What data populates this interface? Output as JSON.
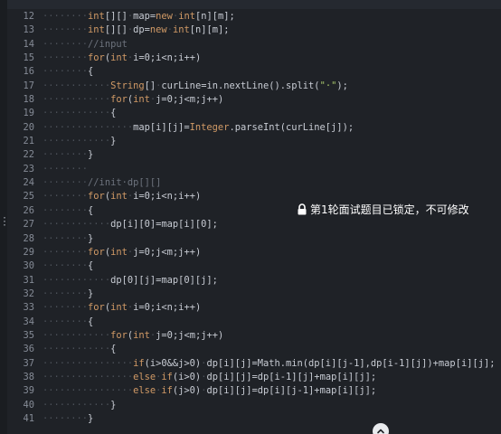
{
  "editor": {
    "lines": [
      {
        "n": "12",
        "indent": 2,
        "parts": [
          [
            "kw",
            "int"
          ],
          [
            "",
            "[][]"
          ],
          [
            "dot",
            "·"
          ],
          [
            "",
            "map="
          ],
          [
            "kw",
            "new"
          ],
          [
            "dot",
            "·"
          ],
          [
            "kw",
            "int"
          ],
          [
            "",
            "[n][m];"
          ]
        ]
      },
      {
        "n": "13",
        "indent": 2,
        "parts": [
          [
            "kw",
            "int"
          ],
          [
            "",
            "[][]"
          ],
          [
            "dot",
            "·"
          ],
          [
            "",
            "dp="
          ],
          [
            "kw",
            "new"
          ],
          [
            "dot",
            "·"
          ],
          [
            "kw",
            "int"
          ],
          [
            "",
            "[n][m];"
          ]
        ]
      },
      {
        "n": "14",
        "indent": 2,
        "parts": [
          [
            "cm",
            "//input"
          ]
        ]
      },
      {
        "n": "15",
        "indent": 2,
        "parts": [
          [
            "kw",
            "for"
          ],
          [
            "",
            "("
          ],
          [
            "kw",
            "int"
          ],
          [
            "dot",
            "·"
          ],
          [
            "",
            "i=0;i<n;i++)"
          ]
        ]
      },
      {
        "n": "16",
        "indent": 2,
        "parts": [
          [
            "",
            "{"
          ]
        ]
      },
      {
        "n": "17",
        "indent": 3,
        "parts": [
          [
            "ty",
            "String"
          ],
          [
            "",
            "[]"
          ],
          [
            "dot",
            "·"
          ],
          [
            "",
            "curLine=in.nextLine().split("
          ],
          [
            "str",
            "\"·\""
          ],
          [
            "",
            ");"
          ]
        ]
      },
      {
        "n": "18",
        "indent": 3,
        "parts": [
          [
            "kw",
            "for"
          ],
          [
            "",
            "("
          ],
          [
            "kw",
            "int"
          ],
          [
            "dot",
            "·"
          ],
          [
            "",
            "j=0;j<m;j++)"
          ]
        ]
      },
      {
        "n": "19",
        "indent": 3,
        "parts": [
          [
            "",
            "{"
          ]
        ]
      },
      {
        "n": "20",
        "indent": 4,
        "parts": [
          [
            "",
            "map[i][j]="
          ],
          [
            "ty",
            "Integer"
          ],
          [
            "",
            ".parseInt(curLine[j]);"
          ]
        ]
      },
      {
        "n": "21",
        "indent": 3,
        "parts": [
          [
            "",
            "}"
          ]
        ]
      },
      {
        "n": "22",
        "indent": 2,
        "parts": [
          [
            "",
            "}"
          ]
        ]
      },
      {
        "n": "23",
        "indent": 2,
        "parts": []
      },
      {
        "n": "24",
        "indent": 2,
        "parts": [
          [
            "cm",
            "//init·dp[][]"
          ]
        ]
      },
      {
        "n": "25",
        "indent": 2,
        "parts": [
          [
            "kw",
            "for"
          ],
          [
            "",
            "("
          ],
          [
            "kw",
            "int"
          ],
          [
            "dot",
            "·"
          ],
          [
            "",
            "i=0;i<n;i++)"
          ]
        ]
      },
      {
        "n": "26",
        "indent": 2,
        "parts": [
          [
            "",
            "{"
          ]
        ]
      },
      {
        "n": "27",
        "indent": 3,
        "parts": [
          [
            "",
            "dp[i][0]=map[i][0];"
          ]
        ]
      },
      {
        "n": "28",
        "indent": 2,
        "parts": [
          [
            "",
            "}"
          ]
        ]
      },
      {
        "n": "29",
        "indent": 2,
        "parts": [
          [
            "kw",
            "for"
          ],
          [
            "",
            "("
          ],
          [
            "kw",
            "int"
          ],
          [
            "dot",
            "·"
          ],
          [
            "",
            "j=0;j<m;j++)"
          ]
        ]
      },
      {
        "n": "30",
        "indent": 2,
        "parts": [
          [
            "",
            "{"
          ]
        ]
      },
      {
        "n": "31",
        "indent": 3,
        "parts": [
          [
            "",
            "dp[0][j]=map[0][j];"
          ]
        ]
      },
      {
        "n": "32",
        "indent": 2,
        "parts": [
          [
            "",
            "}"
          ]
        ]
      },
      {
        "n": "33",
        "indent": 2,
        "parts": [
          [
            "kw",
            "for"
          ],
          [
            "",
            "("
          ],
          [
            "kw",
            "int"
          ],
          [
            "dot",
            "·"
          ],
          [
            "",
            "i=0;i<n;i++)"
          ]
        ]
      },
      {
        "n": "34",
        "indent": 2,
        "parts": [
          [
            "",
            "{"
          ]
        ]
      },
      {
        "n": "35",
        "indent": 3,
        "parts": [
          [
            "kw",
            "for"
          ],
          [
            "",
            "("
          ],
          [
            "kw",
            "int"
          ],
          [
            "dot",
            "·"
          ],
          [
            "",
            "j=0;j<m;j++)"
          ]
        ]
      },
      {
        "n": "36",
        "indent": 3,
        "parts": [
          [
            "",
            "{"
          ]
        ]
      },
      {
        "n": "37",
        "indent": 4,
        "parts": [
          [
            "kw",
            "if"
          ],
          [
            "",
            "(i>0&&j>0)"
          ],
          [
            "dot",
            "·"
          ],
          [
            "",
            "dp[i][j]=Math.min(dp[i][j-1],dp[i-1][j])+map[i][j];"
          ]
        ]
      },
      {
        "n": "38",
        "indent": 4,
        "parts": [
          [
            "kw",
            "else"
          ],
          [
            "dot",
            "·"
          ],
          [
            "kw",
            "if"
          ],
          [
            "",
            "(i>0)"
          ],
          [
            "dot",
            "·"
          ],
          [
            "",
            "dp[i][j]=dp[i-1][j]+map[i][j];"
          ]
        ]
      },
      {
        "n": "39",
        "indent": 4,
        "parts": [
          [
            "kw",
            "else"
          ],
          [
            "dot",
            "·"
          ],
          [
            "kw",
            "if"
          ],
          [
            "",
            "(j>0)"
          ],
          [
            "dot",
            "·"
          ],
          [
            "",
            "dp[i][j]=dp[i][j-1]+map[i][j];"
          ]
        ]
      },
      {
        "n": "40",
        "indent": 3,
        "parts": [
          [
            "",
            "}"
          ]
        ]
      },
      {
        "n": "41",
        "indent": 2,
        "parts": [
          [
            "",
            "}"
          ]
        ]
      }
    ]
  },
  "notice": {
    "text": "第1轮面试题目已锁定，不可修改",
    "icon": "lock-icon"
  },
  "scroll_button": {
    "icon": "chevron-up-icon"
  },
  "colors": {
    "background": "#1f2227",
    "keyword": "#d19a66",
    "comment": "#6d737d",
    "string": "#a6c46a",
    "text": "#c8ccd4",
    "line_number": "#858b96"
  }
}
